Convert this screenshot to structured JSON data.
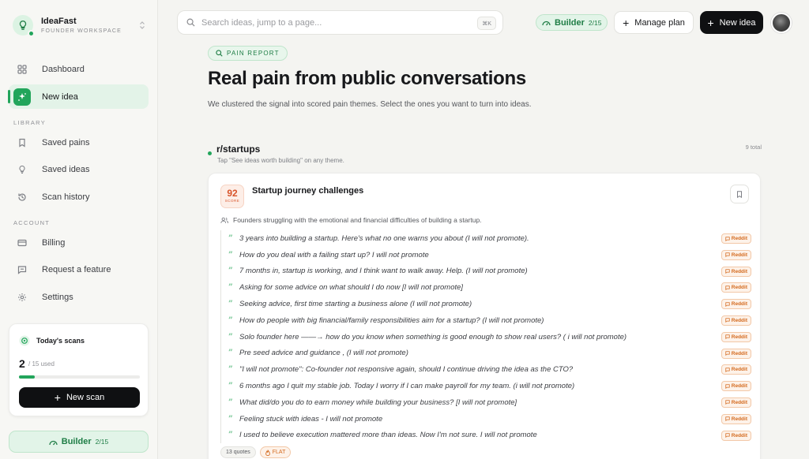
{
  "brand": {
    "name": "IdeaFast",
    "subtitle": "FOUNDER WORKSPACE",
    "logo_icon": "lightbulb-icon"
  },
  "nav": {
    "main": [
      {
        "label": "Dashboard",
        "icon": "grid-icon",
        "active": false
      },
      {
        "label": "New idea",
        "icon": "sparkle-icon",
        "active": true
      }
    ],
    "library_label": "LIBRARY",
    "library": [
      {
        "label": "Saved pains",
        "icon": "bookmark-icon"
      },
      {
        "label": "Saved ideas",
        "icon": "lightbulb-icon"
      },
      {
        "label": "Scan history",
        "icon": "history-icon"
      }
    ],
    "account_label": "ACCOUNT",
    "account": [
      {
        "label": "Billing",
        "icon": "credit-card-icon"
      },
      {
        "label": "Request a feature",
        "icon": "message-icon"
      },
      {
        "label": "Settings",
        "icon": "gear-icon"
      }
    ]
  },
  "scans": {
    "title": "Today's scans",
    "used": "2",
    "limit_text": "/ 15 used",
    "progress": 0.1333,
    "button": "New scan"
  },
  "plan": {
    "name": "Builder",
    "count": "2/15"
  },
  "topbar": {
    "search_placeholder": "Search ideas, jump to a page...",
    "shortcut": "⌘K",
    "manage_plan": "Manage plan",
    "new_idea": "New idea"
  },
  "report": {
    "badge": "PAIN REPORT",
    "title": "Real pain from public conversations",
    "intro": "We clustered the signal into scored pain themes. Select the ones you want to turn into ideas.",
    "subreddit": "r/startups",
    "hint": "Tap \"See ideas worth building\" on any theme.",
    "total": "9 total"
  },
  "theme": {
    "score": "92",
    "score_label": "SCORE",
    "title": "Startup journey challenges",
    "description": "Founders struggling with the emotional and financial difficulties of building a startup.",
    "quotes": [
      {
        "text": "3 years into building a startup. Here's what no one warns you about (I will not promote).",
        "source": "Reddit"
      },
      {
        "text": "How do you deal with a failing start up? I will not promote",
        "source": "Reddit"
      },
      {
        "text": "7 months in, startup is working, and I think want to walk away. Help. (I will not promote)",
        "source": "Reddit"
      },
      {
        "text": "Asking for some advice on what should I do now [I will not promote]",
        "source": "Reddit"
      },
      {
        "text": "Seeking advice, first time starting a business alone (I will not promote)",
        "source": "Reddit"
      },
      {
        "text": "How do people with big financial/family responsibilities aim for a startup? (I will not promote)",
        "source": "Reddit"
      },
      {
        "text": "Solo founder here ——→ how do you know when something is good enough to show real users? ( i will not promote)",
        "source": "Reddit"
      },
      {
        "text": "Pre seed advice and guidance , (I will not promote)",
        "source": "Reddit"
      },
      {
        "text": "\"I will not promote\": Co-founder not responsive again, should I continue driving the idea as the CTO?",
        "source": "Reddit"
      },
      {
        "text": "6 months ago I quit my stable job. Today I worry if I can make payroll for my team. (i will not promote)",
        "source": "Reddit"
      },
      {
        "text": "What did/do you do to earn money while building your business? [I will not promote]",
        "source": "Reddit"
      },
      {
        "text": "Feeling stuck with ideas - I will not promote",
        "source": "Reddit"
      },
      {
        "text": "I used to believe execution mattered more than ideas. Now I'm not sure. I will not promote",
        "source": "Reddit"
      }
    ],
    "tag_quotes": "13 quotes",
    "tag_trend": "FLAT"
  },
  "colors": {
    "accent": "#22a55b",
    "accent_soft": "#e2f4e8",
    "score": "#d8542a",
    "source": "#d46a1e",
    "primary_button": "#0f1012"
  }
}
